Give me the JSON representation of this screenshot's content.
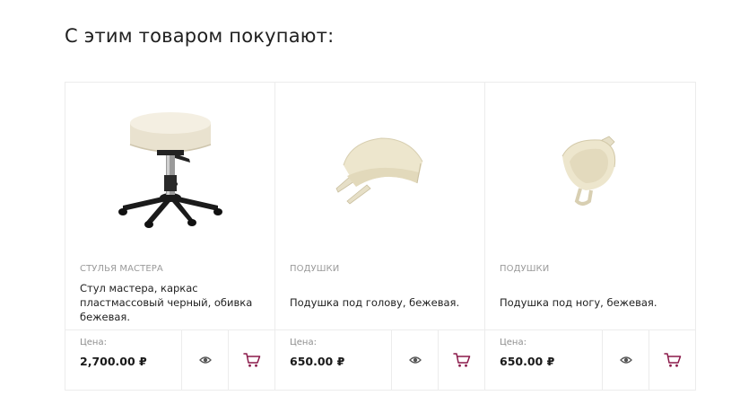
{
  "section": {
    "title": "С этим товаром покупают:"
  },
  "price_label": "Цена:",
  "products": [
    {
      "category": "СТУЛЬЯ МАСТЕРА",
      "name": "Стул мастера, каркас пластмассовый черный, обивка бежевая.",
      "price": "2,700.00 ₽",
      "image": "stool-image"
    },
    {
      "category": "ПОДУШКИ",
      "name": "Подушка под голову, бежевая.",
      "price": "650.00 ₽",
      "image": "head-pillow-image"
    },
    {
      "category": "ПОДУШКИ",
      "name": "Подушка под ногу, бежевая.",
      "price": "650.00 ₽",
      "image": "leg-pillow-image"
    }
  ],
  "colors": {
    "cart_icon": "#8b1a4a",
    "eye_icon": "#555555",
    "border": "#ececec",
    "category_text": "#9a9a9a"
  },
  "icons": {
    "quick_view": "eye-icon",
    "add_to_cart": "cart-icon"
  }
}
